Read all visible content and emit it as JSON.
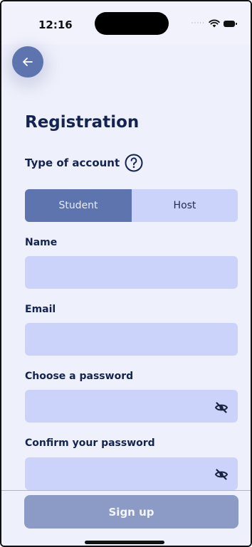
{
  "status_bar": {
    "time": "12:16",
    "signal_dots": "·····",
    "icons": [
      "wifi-icon",
      "battery-icon"
    ]
  },
  "header": {
    "back_icon": "arrow-left-icon"
  },
  "form": {
    "title": "Registration",
    "account_type_label": "Type of account",
    "help_icon": "question-circle-icon",
    "account_types": [
      {
        "label": "Student",
        "selected": true
      },
      {
        "label": "Host",
        "selected": false
      }
    ],
    "name": {
      "label": "Name",
      "value": "",
      "placeholder": ""
    },
    "email": {
      "label": "Email",
      "value": "",
      "placeholder": ""
    },
    "password": {
      "label": "Choose a password",
      "value": "",
      "placeholder": "",
      "visibility_icon": "eye-off-icon"
    },
    "confirm_password": {
      "label": "Confirm your password",
      "value": "",
      "placeholder": "",
      "visibility_icon": "eye-off-icon"
    }
  },
  "footer": {
    "signup_label": "Sign up"
  },
  "colors": {
    "primary": "#5d74ae",
    "field_bg": "#ccd3fb",
    "page_bg": "#eef0fb",
    "text_dark": "#14234f",
    "button_disabled": "#8c9bc5"
  }
}
